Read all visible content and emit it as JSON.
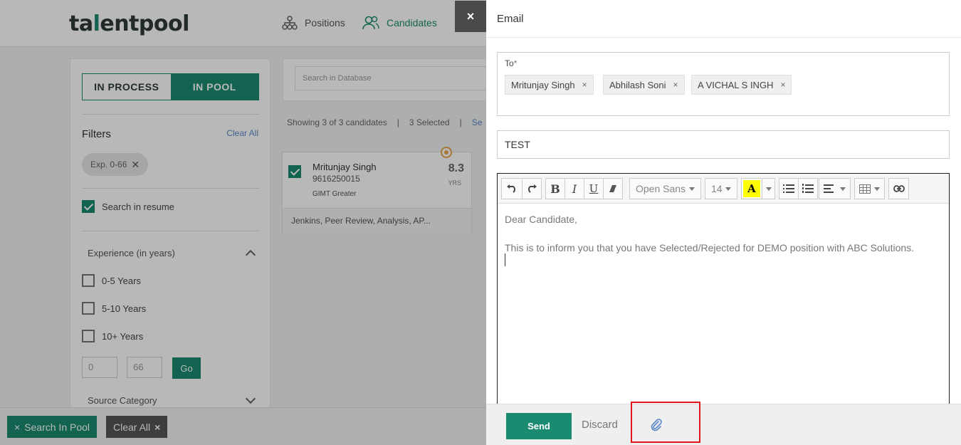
{
  "app": {
    "logo": {
      "part1": "ta",
      "accent": "l",
      "part2": "entpool"
    },
    "nav": {
      "positions": "Positions",
      "candidates": "Candidates"
    }
  },
  "filters": {
    "tab_in_process": "IN PROCESS",
    "tab_in_pool": "IN POOL",
    "title": "Filters",
    "clear_all": "Clear All",
    "chip": "Exp. 0-66",
    "search_in_resume": "Search in resume",
    "experience_title": "Experience (in years)",
    "exp_options": [
      "0-5 Years",
      "5-10 Years",
      "10+ Years"
    ],
    "range_min": "0",
    "range_max": "66",
    "go": "Go",
    "source_title": "Source Category"
  },
  "results": {
    "search_placeholder": "Search in Database",
    "showing": "Showing 3 of 3 candidates",
    "sep": "|",
    "selected": "3 Selected",
    "link": "Se"
  },
  "candidate": {
    "name": "Mritunjay Singh",
    "phone": "9616250015",
    "college": "GIMT Greater",
    "exp": "8.3",
    "exp_unit": "YRS",
    "skills": "Jenkins, Peer Review, Analysis, AP..."
  },
  "bottom": {
    "search_pool": "Search In Pool",
    "clear_all": "Clear All"
  },
  "email": {
    "close": "×",
    "title": "Email",
    "to_label": "To",
    "to_star": "*",
    "recipients": [
      "Mritunjay Singh",
      "Abhilash Soni",
      "A VICHAL S INGH"
    ],
    "remove_symbol": "×",
    "subject": "TEST",
    "toolbar": {
      "bold": "B",
      "italic": "I",
      "underline": "U",
      "font": "Open Sans",
      "size": "14",
      "highlight": "A"
    },
    "body_line1": "Dear Candidate,",
    "body_line2": "This is to inform you that you have Selected/Rejected for DEMO position with ABC Solutions.",
    "send": "Send",
    "discard": "Discard"
  },
  "colors": {
    "brand": "#1a8a70",
    "highlight_box": "#e0161b",
    "text_highlight": "#ffff00"
  },
  "icons": [
    "positions-icon",
    "candidates-icon",
    "undo-icon",
    "redo-icon",
    "eraser-icon",
    "bullet-list-icon",
    "numbered-list-icon",
    "align-icon",
    "table-icon",
    "link-icon",
    "paperclip-icon",
    "eye-icon",
    "close-icon"
  ]
}
